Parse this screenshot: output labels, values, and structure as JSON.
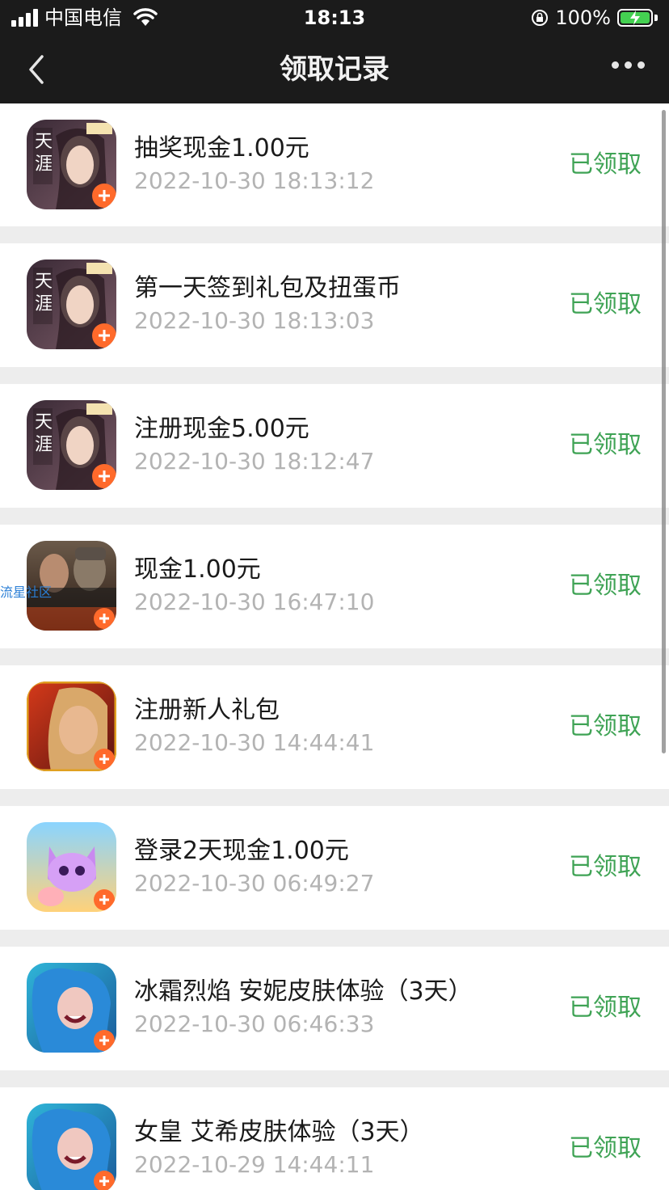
{
  "status_bar": {
    "carrier": "中国电信",
    "time": "18:13",
    "battery": "100%"
  },
  "nav": {
    "title": "领取记录"
  },
  "watermark": "流星社区",
  "records": [
    {
      "title": "抽奖现金1.00元",
      "time": "2022-10-30 18:13:12",
      "status": "已领取",
      "icon": "tianya-game-icon"
    },
    {
      "title": "第一天签到礼包及扭蛋币",
      "time": "2022-10-30 18:13:03",
      "status": "已领取",
      "icon": "tianya-game-icon"
    },
    {
      "title": "注册现金5.00元",
      "time": "2022-10-30 18:12:47",
      "status": "已领取",
      "icon": "tianya-game-icon"
    },
    {
      "title": "现金1.00元",
      "time": "2022-10-30 16:47:10",
      "status": "已领取",
      "icon": "call-of-duty-icon"
    },
    {
      "title": "注册新人礼包",
      "time": "2022-10-30 14:44:41",
      "status": "已领取",
      "icon": "5v5-game-icon"
    },
    {
      "title": "登录2天现金1.00元",
      "time": "2022-10-30 06:49:27",
      "status": "已领取",
      "icon": "cat-game-icon"
    },
    {
      "title": "冰霜烈焰 安妮皮肤体验（3天）",
      "time": "2022-10-30 06:46:33",
      "status": "已领取",
      "icon": "jinx-game-icon"
    },
    {
      "title": "女皇 艾希皮肤体验（3天）",
      "time": "2022-10-29 14:44:11",
      "status": "已领取",
      "icon": "jinx-game-icon"
    }
  ],
  "colors": {
    "header_bg": "#1b1b1b",
    "page_bg": "#ededed",
    "status_green": "#3fa355",
    "time_gray": "#b3b3b3"
  }
}
